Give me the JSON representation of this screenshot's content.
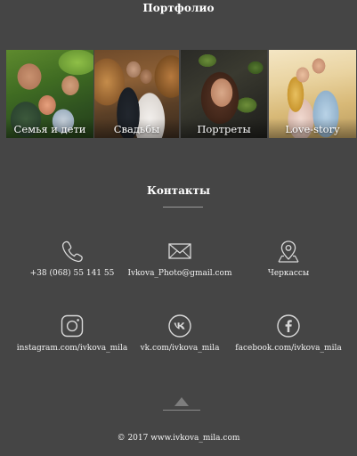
{
  "portfolio": {
    "title": "Портфолио",
    "tiles": [
      {
        "label": "Семья и дети"
      },
      {
        "label": "Свадьбы"
      },
      {
        "label": "Портреты"
      },
      {
        "label": "Love-story"
      }
    ]
  },
  "contacts": {
    "title": "Контакты",
    "items": [
      {
        "icon": "phone-icon",
        "text": "+38 (068) 55 141 55"
      },
      {
        "icon": "mail-icon",
        "text": "Ivkova_Photo@gmail.com"
      },
      {
        "icon": "location-pin-icon",
        "text": "Черкассы"
      },
      {
        "icon": "instagram-icon",
        "text": "instagram.com/ivkova_mila"
      },
      {
        "icon": "vk-icon",
        "text": "vk.com/ivkova_mila"
      },
      {
        "icon": "facebook-icon",
        "text": "facebook.com/ivkova_mila"
      }
    ]
  },
  "footer": {
    "copyright": "© 2017 www.ivkova_mila.com"
  },
  "colors": {
    "background": "#454545",
    "text": "#ffffff",
    "icon": "#d8d8d8",
    "divider": "#9a9a9a"
  }
}
